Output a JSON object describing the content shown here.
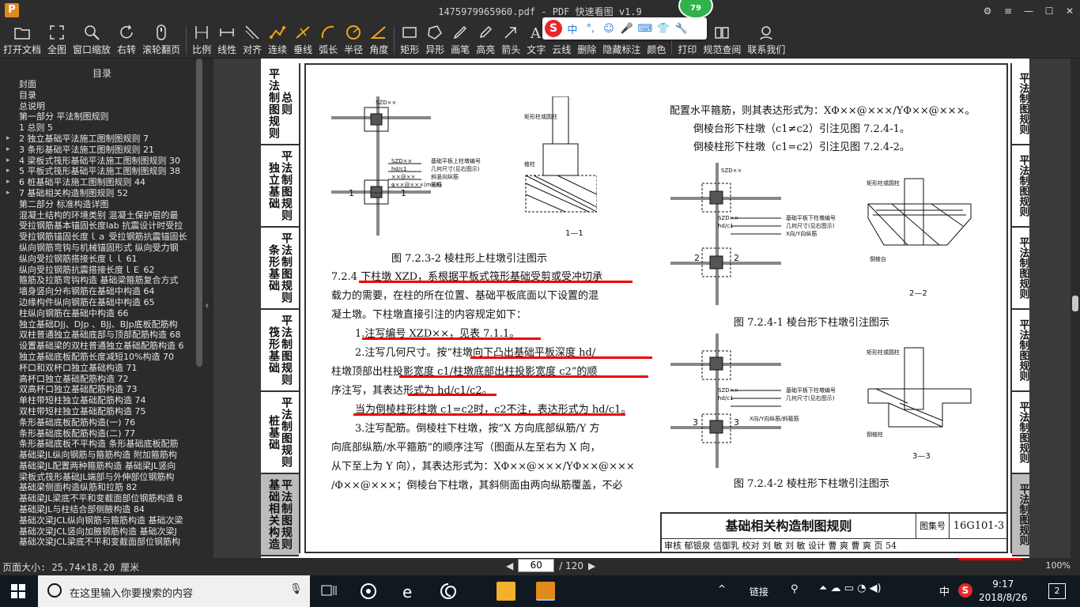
{
  "window": {
    "title": "1475979965960.pdf - PDF 快速看图 v1.9",
    "badge": "79",
    "logo": "P"
  },
  "toolbar": {
    "items": [
      {
        "label": "打开文档",
        "icon": "folder-icon"
      },
      {
        "label": "全图",
        "icon": "fullscreen-icon"
      },
      {
        "label": "窗口缩放",
        "icon": "zoom-icon"
      },
      {
        "label": "右转",
        "icon": "rotate-icon"
      },
      {
        "label": "滚轮翻页",
        "icon": "mouse-icon"
      },
      {
        "label": "比例",
        "icon": "scale-icon"
      },
      {
        "label": "线性",
        "icon": "linear-icon"
      },
      {
        "label": "对齐",
        "icon": "align-icon"
      },
      {
        "label": "连续",
        "icon": "continuous-icon"
      },
      {
        "label": "垂线",
        "icon": "perpendicular-icon"
      },
      {
        "label": "弧长",
        "icon": "arc-icon"
      },
      {
        "label": "半径",
        "icon": "radius-icon"
      },
      {
        "label": "角度",
        "icon": "angle-icon"
      },
      {
        "label": "矩形",
        "icon": "rectangle-icon"
      },
      {
        "label": "异形",
        "icon": "polygon-icon"
      },
      {
        "label": "画笔",
        "icon": "pen-icon"
      },
      {
        "label": "高亮",
        "icon": "highlight-icon"
      },
      {
        "label": "箭头",
        "icon": "arrow-icon"
      },
      {
        "label": "文字",
        "icon": "text-icon"
      },
      {
        "label": "云线",
        "icon": "cloud-icon"
      },
      {
        "label": "删除",
        "icon": "eraser-icon"
      },
      {
        "label": "隐藏标注",
        "icon": "eye-icon"
      },
      {
        "label": "颜色",
        "icon": "color-icon"
      },
      {
        "label": "打印",
        "icon": "print-icon"
      },
      {
        "label": "规范查阅",
        "icon": "book-icon"
      },
      {
        "label": "联系我们",
        "icon": "contact-icon"
      }
    ],
    "ime": [
      "中",
      "°,",
      "☺",
      "🎤",
      "⌨",
      "👕",
      "🔧"
    ]
  },
  "sidebar": {
    "title": "目录",
    "items": [
      {
        "label": "封面",
        "arrow": ""
      },
      {
        "label": "目录",
        "arrow": ""
      },
      {
        "label": "总说明",
        "arrow": ""
      },
      {
        "label": "第一部分  平法制图规则",
        "arrow": ""
      },
      {
        "label": "1 总则 5",
        "arrow": ""
      },
      {
        "label": "2 独立基础平法施工图制图规则 7",
        "arrow": "▸"
      },
      {
        "label": "3 条形基础平法施工图制图规则 21",
        "arrow": "▸"
      },
      {
        "label": "4 梁板式筏形基础平法施工图制图规则 30",
        "arrow": "▸"
      },
      {
        "label": "5 平板式筏形基础平法施工图制图规则 38",
        "arrow": "▸"
      },
      {
        "label": "6 桩基础平法施工图制图规则 44",
        "arrow": "▸"
      },
      {
        "label": "7 基础相关构造制图规则 52",
        "arrow": "▸"
      },
      {
        "label": "第二部分  标准构造详图",
        "arrow": ""
      },
      {
        "label": "混凝土结构的环境类别 混凝土保护层的最",
        "arrow": ""
      },
      {
        "label": "受拉钢筋基本锚固长度lab 抗震设计时受拉",
        "arrow": ""
      },
      {
        "label": "受拉钢筋锚固长度ｌａ 受拉钢筋抗震锚固长",
        "arrow": ""
      },
      {
        "label": "纵向钢筋弯钩与机械锚固形式 纵向受力钢",
        "arrow": ""
      },
      {
        "label": "纵向受拉钢筋搭接长度ｌｌ 61",
        "arrow": ""
      },
      {
        "label": "纵向受拉钢筋抗震搭接长度ｌＥ 62",
        "arrow": ""
      },
      {
        "label": "箍筋及拉筋弯钩构造 基础梁箍筋复合方式",
        "arrow": ""
      },
      {
        "label": "墙身竖向分布钢筋在基础中构造 64",
        "arrow": ""
      },
      {
        "label": "边缘构件纵向钢筋在基础中构造 65",
        "arrow": ""
      },
      {
        "label": "柱纵向钢筋在基础中构造 66",
        "arrow": ""
      },
      {
        "label": "独立基础DJj、DJp 、BJj、BJp底板配筋构",
        "arrow": ""
      },
      {
        "label": "双柱普通独立基础底部与顶部配筋构造 68",
        "arrow": ""
      },
      {
        "label": "设置基础梁的双柱普通独立基础配筋构造 6",
        "arrow": ""
      },
      {
        "label": "独立基础底板配筋长度减短10%构造 70",
        "arrow": ""
      },
      {
        "label": "杯口和双杯口独立基础构造 71",
        "arrow": ""
      },
      {
        "label": "高杯口独立基础配筋构造 72",
        "arrow": ""
      },
      {
        "label": "双高杯口独立基础配筋构造 73",
        "arrow": ""
      },
      {
        "label": "单柱带短柱独立基础配筋构造 74",
        "arrow": ""
      },
      {
        "label": "双柱带短柱独立基础配筋构造 75",
        "arrow": ""
      },
      {
        "label": "条形基础底板配筋构造(一) 76",
        "arrow": ""
      },
      {
        "label": "条形基础底板配筋构造(二) 77",
        "arrow": ""
      },
      {
        "label": "条形基础底板不平构造 条形基础底板配筋",
        "arrow": ""
      },
      {
        "label": "基础梁JL纵向钢筋与箍筋构造 附加箍筋构",
        "arrow": ""
      },
      {
        "label": "基础梁JL配置两种箍筋构造 基础梁JL竖向",
        "arrow": ""
      },
      {
        "label": "梁板式筏形基础JL端部与外伸部位钢筋构",
        "arrow": ""
      },
      {
        "label": "基础梁侧面构造纵筋和拉筋 82",
        "arrow": ""
      },
      {
        "label": "基础梁JL梁底不平和变截面部位钢筋构造 8",
        "arrow": ""
      },
      {
        "label": "基础梁JL与柱结合部侧腋构造 84",
        "arrow": ""
      },
      {
        "label": "基础次梁JCL纵向钢筋与箍筋构造 基础次梁",
        "arrow": ""
      },
      {
        "label": "基础次梁JCL竖向加腋钢筋构造 基础次梁J",
        "arrow": ""
      },
      {
        "label": "基础次梁JCL梁底不平和变截面部位钢筋构",
        "arrow": ""
      }
    ]
  },
  "document": {
    "left_tabs": [
      "平法制图规则总则",
      "独立基础",
      "条形基础",
      "筏形基础",
      "桩基础",
      "基础相关构造"
    ],
    "left_tab_labels": [
      "平法制图规则",
      "独立基础",
      "条形基础",
      "筏形基础",
      "桩基础",
      "基础相关构造"
    ],
    "left_tab_sub": [
      "总则",
      "平法制图规则",
      "平法制图规则",
      "平法制图规则",
      "平法制图规则",
      "平法制图规则"
    ],
    "right_tabs": [
      "平法制图规则",
      "平法制图规则",
      "平法制图规则",
      "平法制图规则",
      "平法制图规则",
      "平法制图规则"
    ],
    "fig_left_caption": "图 7.2.3-2  棱柱形上柱墩引注图示",
    "fig_right_top_caption": "图 7.2.4-1  棱台形下柱墩引注图示",
    "fig_right_bottom_caption": "图 7.2.4-2  棱柱形下柱墩引注图示",
    "section_labels": {
      "s11": "1—1",
      "s22": "2—2",
      "s33": "3—3"
    },
    "diagram_text": {
      "szd": "SZD××",
      "hd": "hd/c1",
      "xx": "××@××",
      "phi": "φ××@×××(m×n)",
      "note1": "基础平板上柱墩编号",
      "note2": "几何尺寸(见右图示)",
      "note3": "斜竖向纵筋",
      "note4": "箍筋",
      "rect_col": "矩形柱或圆柱",
      "prism": "棱柱",
      "prism_r": "棱台",
      "dia_note1": "基础平板下柱墩编号",
      "dia_note2": "几何尺寸(见右图示)",
      "dia_note3": "X向/Y向纵筋",
      "dia_note4": "X向/Y向纵筋/斜箍筋",
      "rect_col2": "矩形柱或圆柱",
      "rect_col3": "矩形柱或圆柱",
      "dp_label": "倒棱台",
      "dpz_label": "倒棱柱"
    },
    "right_lines": [
      "配置水平箍筋，则其表达形式为：XΦ××@×××/YΦ××@×××。",
      "倒棱台形下柱墩（c1≠c2）引注见图 7.2.4-1。",
      "倒棱柱形下柱墩（c1=c2）引注见图 7.2.4-2。"
    ],
    "left_lines": [
      "7.2.4  下柱墩 XZD，系根据平板式筏形基础受剪或受冲切承",
      "载力的需要，在柱的所在位置、基础平板底面以下设置的混",
      "凝土墩。下柱墩直接引注的内容规定如下：",
      "1.注写编号 XZD××，见表 7.1.1。",
      "2.注写几何尺寸。按“柱墩向下凸出基础平板深度 hd/",
      "柱墩顶部出柱投影宽度 c1/柱墩底部出柱投影宽度 c2”的顺",
      "序注写，其表达形式为 hd/c1/c2。",
      "当为倒棱柱形柱墩 c1=c2时，c2不注，表达形式为 hd/c1。",
      "3.注写配筋。倒棱柱下柱墩，按“X 方向底部纵筋/Y 方",
      "向底部纵筋/水平箍筋”的顺序注写（图面从左至右为 X 向，",
      "从下至上为 Y 向），其表达形式为：XΦ××@×××/YΦ××@×××",
      "/Φ××@×××；倒棱台下柱墩，其斜侧面由两向纵筋覆盖，不必"
    ],
    "title_block": {
      "title": "基础相关构造制图规则",
      "set_label": "图集号",
      "set_value": "16G101-3",
      "row": "审核 郁银泉 信御乳  校对 刘  敏  刘 敏  设计 曹  爽  曹 爽     页      54"
    }
  },
  "status": {
    "page_size": "页面大小: 25.74×18.20 厘米",
    "current_page": "60",
    "total_pages": "/ 120",
    "zoom": "100%"
  },
  "taskbar": {
    "search_placeholder": "在这里输入你要搜索的内容",
    "tray_text": "链接",
    "ime": "中",
    "time": "9:17",
    "date": "2018/8/26",
    "notifications": "2"
  },
  "colors": {
    "accent_red": "#e00000",
    "toolbar_bg": "#2d2d2d",
    "taskbar_bg": "#101820",
    "badge_green": "#2fb34a"
  }
}
